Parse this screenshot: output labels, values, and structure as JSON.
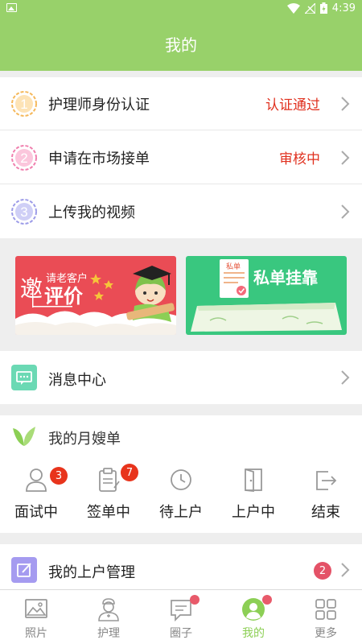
{
  "status_bar": {
    "time": "4:39"
  },
  "header": {
    "title": "我的"
  },
  "auth_rows": [
    {
      "num": "1",
      "label": "护理师身份认证",
      "status": "认证通过",
      "color": "#f5b85a"
    },
    {
      "num": "2",
      "label": "申请在市场接单",
      "status": "审核中",
      "color": "#f07fae"
    },
    {
      "num": "3",
      "label": "上传我的视频",
      "status": "",
      "color": "#9c9be8"
    }
  ],
  "banners": {
    "left": {
      "big": "邀",
      "small": "请老客户",
      "main": "评价"
    },
    "right": {
      "stamp": "私单",
      "main": "私单挂靠"
    }
  },
  "messages": {
    "label": "消息中心"
  },
  "orders": {
    "title": "我的月嫂单",
    "items": [
      {
        "label": "面试中",
        "badge": "3"
      },
      {
        "label": "签单中",
        "badge": "7"
      },
      {
        "label": "待上户",
        "badge": ""
      },
      {
        "label": "上户中",
        "badge": ""
      },
      {
        "label": "结束",
        "badge": ""
      }
    ]
  },
  "manage": {
    "label": "我的上户管理",
    "badge": "2"
  },
  "tabs": [
    {
      "label": "照片"
    },
    {
      "label": "护理"
    },
    {
      "label": "圈子"
    },
    {
      "label": "我的"
    },
    {
      "label": "更多"
    }
  ],
  "colors": {
    "brand_green": "#98d16a",
    "alert_red": "#e0301e",
    "badge_red": "#e8341c"
  }
}
